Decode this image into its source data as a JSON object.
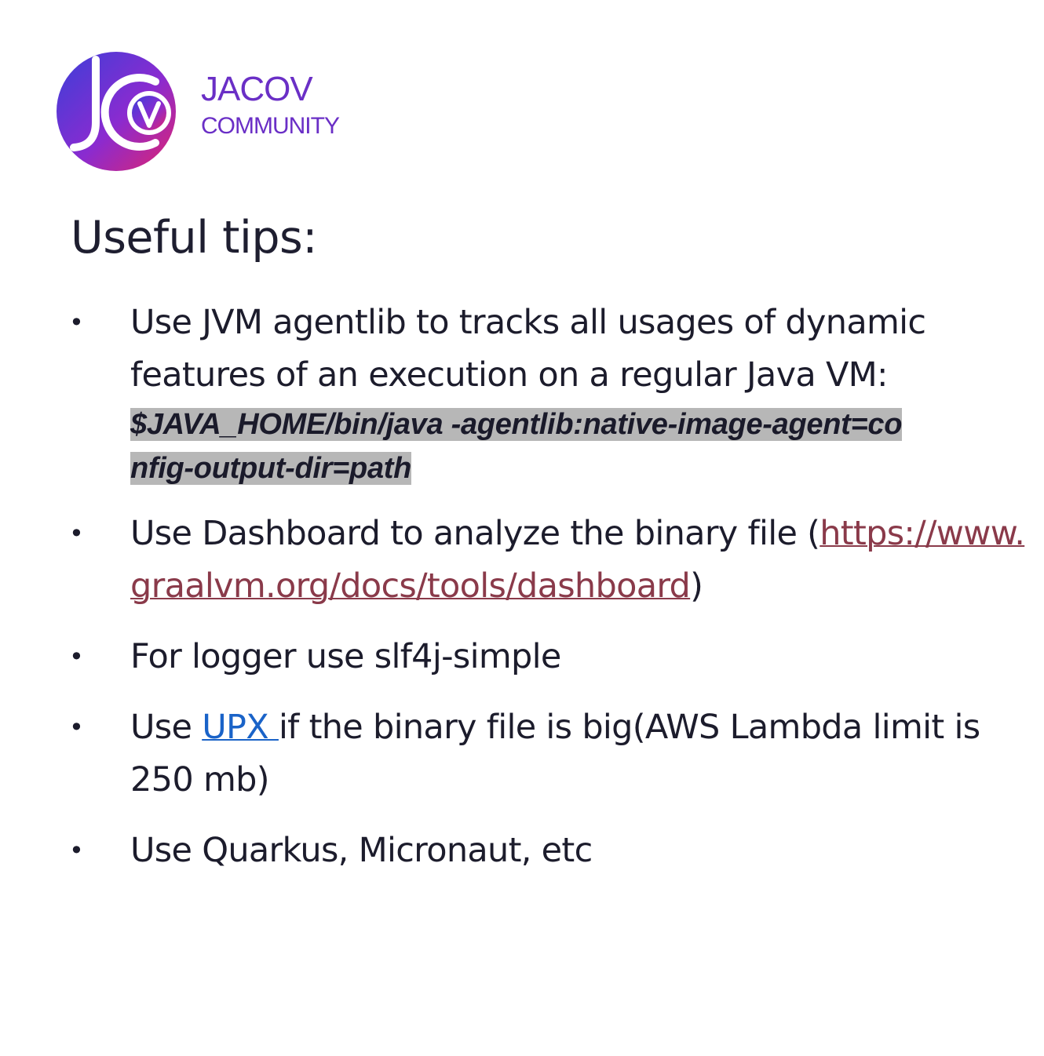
{
  "logo": {
    "line1": "JACOV",
    "line2": "COMMUNITY",
    "colors": {
      "gradient_start": "#3b3fd8",
      "gradient_mid": "#8a2bd0",
      "gradient_end": "#e0246e",
      "text": "#6a2fc6"
    }
  },
  "title": "Useful tips:",
  "bullet_glyph": "•",
  "tips": [
    {
      "text": "Use JVM agentlib to tracks all usages of dynamic features of an execution on a regular Java VM:",
      "code": "$JAVA_HOME/bin/java -agentlib:native-image-agent=config-output-dir=path"
    },
    {
      "before": "Use Dashboard to analyze the binary file (",
      "link": "https://www.graalvm.org/docs/tools/dashboard",
      "after": ")"
    },
    {
      "text": "For logger use slf4j-simple"
    },
    {
      "before": "Use ",
      "link": "UPX ",
      "after": "if the binary file is big(AWS Lambda limit is 250 mb)"
    },
    {
      "text": "Use Quarkus, Micronaut, etc"
    }
  ]
}
